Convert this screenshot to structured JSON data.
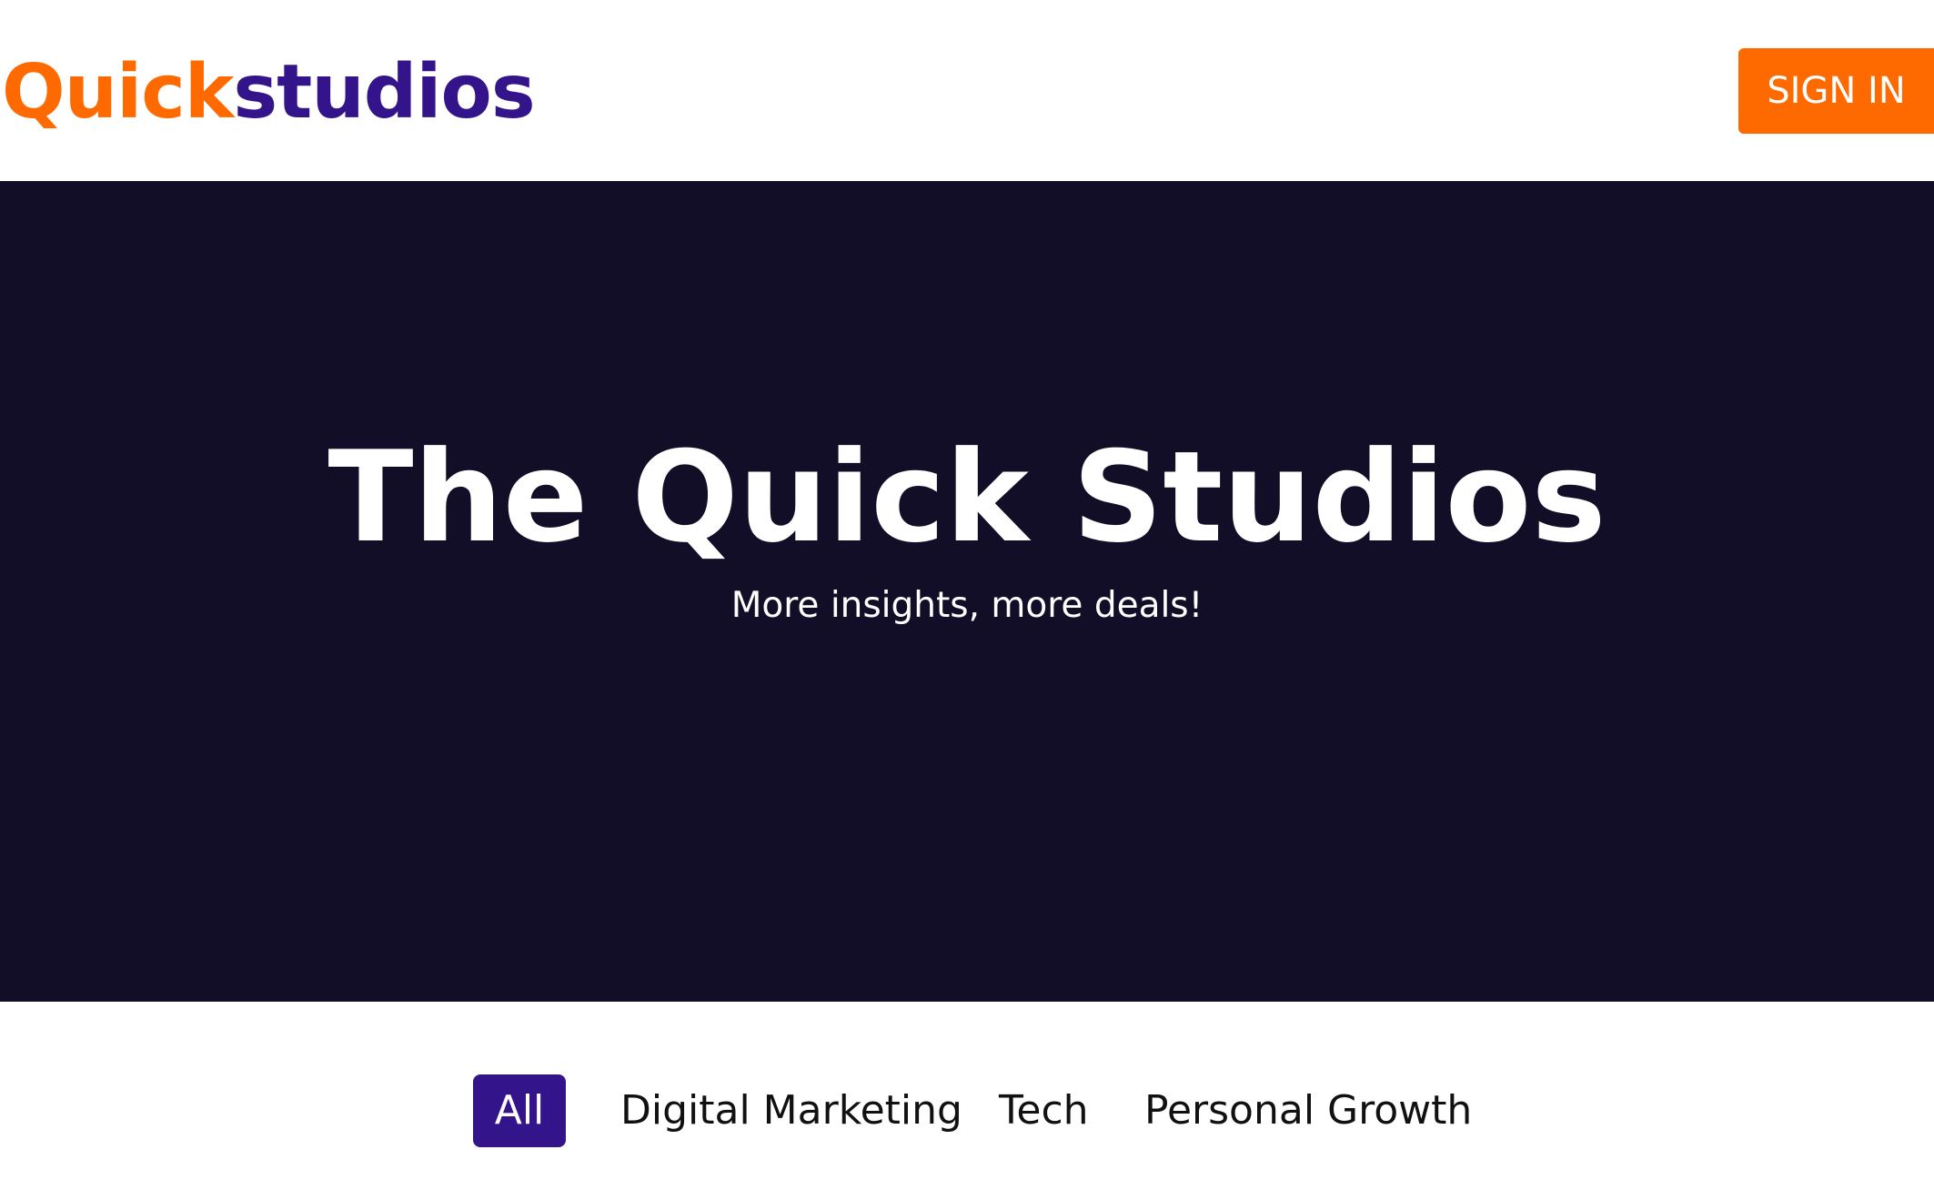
{
  "header": {
    "logo_part1": "Quick",
    "logo_part2": "studios",
    "signin_label": "SIGN IN"
  },
  "hero": {
    "title": "The Quick Studios",
    "subtitle": "More insights, more deals!"
  },
  "filters": [
    {
      "label": "All",
      "active": true
    },
    {
      "label": "Digital Marketing",
      "active": false
    },
    {
      "label": "Tech",
      "active": false
    },
    {
      "label": "Personal Growth",
      "active": false
    }
  ],
  "colors": {
    "brand_orange": "#ff6a00",
    "brand_purple": "#34148a",
    "hero_background": "#120e27"
  }
}
